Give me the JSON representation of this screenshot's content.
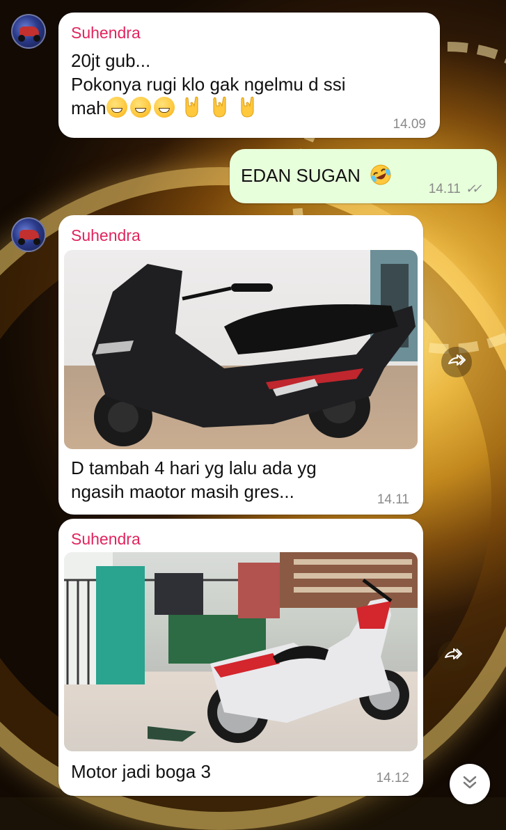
{
  "chat": {
    "messages": [
      {
        "sender": "Suhendra",
        "lines": [
          "20jt gub...",
          "Pokonya rugi klo gak ngelmu d ssi",
          "mah"
        ],
        "time": "14.09",
        "emoji_icons": [
          "grinning-face-icon",
          "grinning-face-icon",
          "grinning-face-icon",
          "sign-of-horns-icon",
          "sign-of-horns-icon",
          "sign-of-horns-icon"
        ]
      },
      {
        "text": "EDAN SUGAN",
        "emoji_icon": "rolling-on-floor-laughing-icon",
        "time": "14.11",
        "status_icon": "double-check-icon"
      },
      {
        "sender": "Suhendra",
        "image": "black-scooter-photo",
        "lines": [
          "D tambah 4 hari yg lalu ada yg",
          "ngasih maotor masih gres..."
        ],
        "time": "14.11"
      },
      {
        "sender": "Suhendra",
        "image": "red-white-scooter-photo",
        "text": "Motor jadi boga 3",
        "time": "14.12"
      }
    ]
  },
  "colors": {
    "sender_name": "#e0245e",
    "incoming_bubble": "#ffffff",
    "outgoing_bubble": "#e7ffdb",
    "timestamp": "#8a8a8a"
  },
  "icons": {
    "forward": "forward-icon",
    "scroll_down": "double-chevron-down-icon",
    "avatar": "avatar"
  }
}
